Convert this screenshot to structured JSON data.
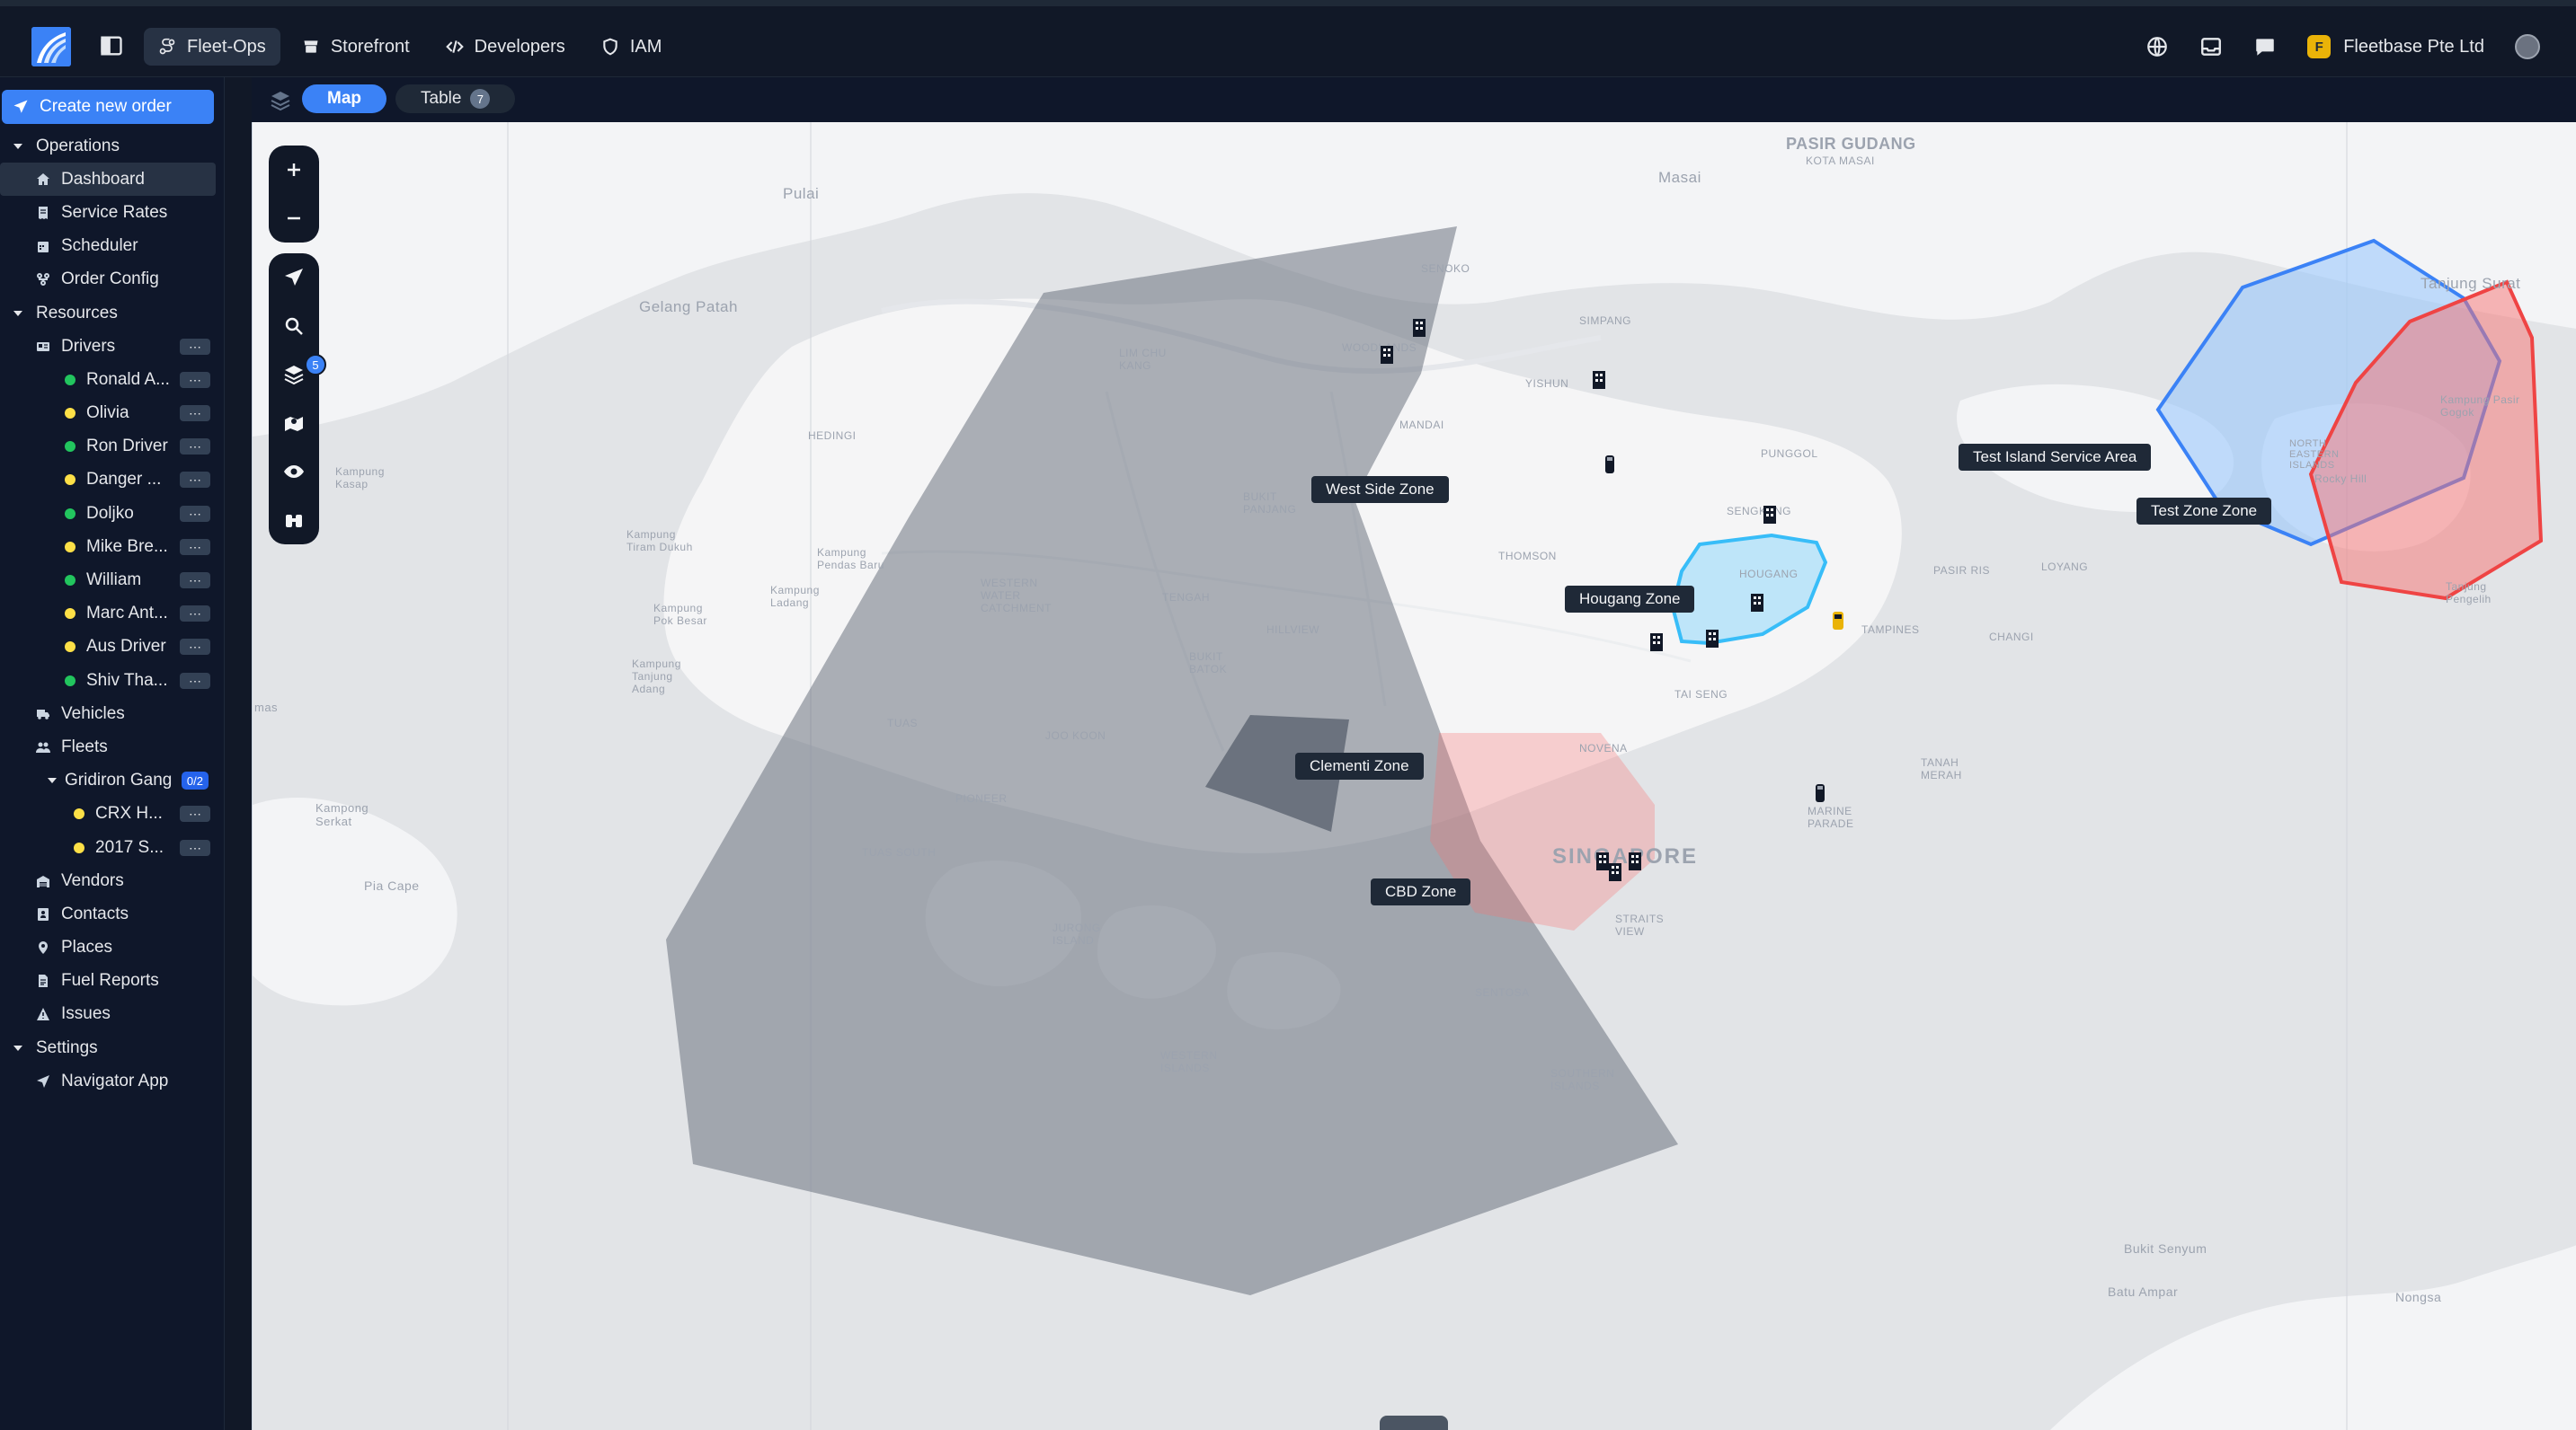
{
  "app": {
    "nav_tabs": [
      {
        "label": "Fleet-Ops",
        "icon": "route-icon"
      },
      {
        "label": "Storefront",
        "icon": "store-icon"
      },
      {
        "label": "Developers",
        "icon": "code-icon"
      },
      {
        "label": "IAM",
        "icon": "shield-icon"
      }
    ],
    "org_initial": "F",
    "org_name": "Fleetbase Pte Ltd"
  },
  "sidebar": {
    "create_label": "Create new order",
    "operations": {
      "label": "Operations",
      "items": [
        "Dashboard",
        "Service Rates",
        "Scheduler",
        "Order Config"
      ]
    },
    "resources": {
      "label": "Resources",
      "drivers_label": "Drivers",
      "drivers": [
        {
          "label": "Ronald A...",
          "status": "#22c55e"
        },
        {
          "label": "Olivia",
          "status": "#fde047"
        },
        {
          "label": "Ron Driver",
          "status": "#22c55e"
        },
        {
          "label": "Danger ...",
          "status": "#fde047"
        },
        {
          "label": "Doljko",
          "status": "#22c55e"
        },
        {
          "label": "Mike Bre...",
          "status": "#fde047"
        },
        {
          "label": "William",
          "status": "#22c55e"
        },
        {
          "label": "Marc Ant...",
          "status": "#fde047"
        },
        {
          "label": "Aus Driver",
          "status": "#fde047"
        },
        {
          "label": "Shiv Tha...",
          "status": "#22c55e"
        }
      ],
      "vehicles_label": "Vehicles",
      "fleets_label": "Fleets",
      "fleet": {
        "label": "Gridiron Gang",
        "count": "0/2"
      },
      "fleet_vehicles": [
        {
          "label": "CRX H...",
          "status": "#fde047"
        },
        {
          "label": "2017 S...",
          "status": "#fde047"
        }
      ],
      "more_items": [
        "Vendors",
        "Contacts",
        "Places",
        "Fuel Reports",
        "Issues"
      ]
    },
    "settings": {
      "label": "Settings",
      "items": [
        "Navigator App"
      ]
    },
    "more_glyph": "⋯"
  },
  "view": {
    "map_label": "Map",
    "table_label": "Table",
    "table_count": "7"
  },
  "map": {
    "layer_count": "5",
    "zones": [
      {
        "name": "West Side Zone",
        "color": "#6b7280"
      },
      {
        "name": "Hougang Zone",
        "color": "#38bdf8"
      },
      {
        "name": "Clementi Zone",
        "color": "#4b5563"
      },
      {
        "name": "CBD Zone",
        "color": "#f87171"
      },
      {
        "name": "Test Island Service Area",
        "color": "#3b82f6"
      },
      {
        "name": "Test Zone Zone",
        "color": "#ef4444"
      }
    ],
    "place_labels": [
      "PASIR GUDANG",
      "KOTA MASAI",
      "Masai",
      "Pulai",
      "Gelang Patah",
      "Tanjung Surat",
      "SINGAPORE",
      "Kampung Pasir Gogok",
      "Tanjung Pengelih",
      "Bukit Senyum",
      "Batu Ampar",
      "Nongsa",
      "Pia Cape",
      "Kampong Serkat",
      "Kampung Pendas Baru",
      "Kampung Tiram Dukuh",
      "Kampung Ladang",
      "Kampung Pok Besar",
      "Kampung Tanjung Adang",
      "Kampung Kasap",
      "Rocky Hill",
      "NORTH EASTERN ISLANDS",
      "PUNGGOL",
      "HOUGANG",
      "TAMPINES",
      "CHANGI",
      "LOYANG",
      "PASIR RIS",
      "SENGKANG",
      "YISHUN",
      "SIMPANG",
      "SENOKO",
      "WOODLANDS",
      "MANDAI",
      "TENGAH",
      "JOO KOON",
      "TUAS",
      "TUAS SOUTH",
      "PIONEER",
      "JURONG ISLAND",
      "WESTERN ISLANDS",
      "SOUTHERN ISLANDS",
      "SENTOSA",
      "MARINE PARADE",
      "NOVENA",
      "TAI SENG",
      "TANAH MERAH",
      "BUKIT BATOK",
      "BUKIT PANJANG",
      "THOMSON",
      "HILLVIEW",
      "WESTERN WATER CATCHMENT",
      "LIM CHU KANG",
      "HEDINGI",
      "STRAITS VIEW",
      "mas"
    ]
  }
}
